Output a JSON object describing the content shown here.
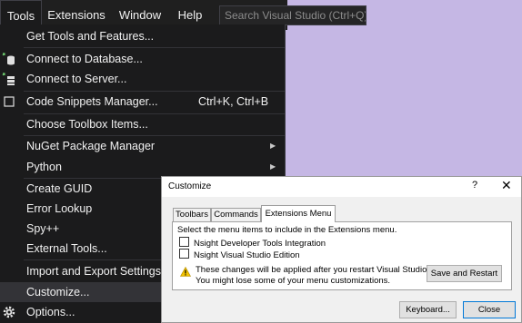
{
  "menubar": {
    "items": [
      {
        "label": "Tools",
        "active": true
      },
      {
        "label": "Extensions"
      },
      {
        "label": "Window"
      },
      {
        "label": "Help"
      }
    ],
    "search_placeholder": "Search Visual Studio (Ctrl+Q)"
  },
  "tools_menu": {
    "items": [
      {
        "label": "Get Tools and Features..."
      },
      {
        "label": "Connect to Database...",
        "icon": "database-connect-icon"
      },
      {
        "label": "Connect to Server...",
        "icon": "server-connect-icon"
      },
      {
        "label": "Code Snippets Manager...",
        "shortcut": "Ctrl+K, Ctrl+B",
        "icon": "snippet-icon"
      },
      {
        "label": "Choose Toolbox Items..."
      },
      {
        "label": "NuGet Package Manager",
        "submenu": true
      },
      {
        "label": "Python",
        "submenu": true
      },
      {
        "label": "Create GUID"
      },
      {
        "label": "Error Lookup"
      },
      {
        "label": "Spy++"
      },
      {
        "label": "External Tools..."
      },
      {
        "label": "Import and Export Settings..."
      },
      {
        "label": "Customize...",
        "highlighted": true
      },
      {
        "label": "Options...",
        "icon": "gear-icon"
      }
    ]
  },
  "dialog": {
    "title": "Customize",
    "help": "?",
    "close_glyph": "✕",
    "tabs": [
      "Toolbars",
      "Commands",
      "Extensions Menu"
    ],
    "active_tab": "Extensions Menu",
    "instruction": "Select the menu items to include in the Extensions menu.",
    "checkboxes": [
      {
        "label": "Nsight Developer Tools Integration",
        "checked": false
      },
      {
        "label": "Nsight Visual Studio Edition",
        "checked": false
      }
    ],
    "warning_line1": "These changes will be applied after you restart Visual Studio.",
    "warning_line2": "You might lose some of your menu customizations.",
    "save_restart": "Save and Restart",
    "keyboard": "Keyboard...",
    "close": "Close"
  },
  "colors": {
    "menu_bg": "#1b1b1c",
    "desktop_bg": "#c5b7e4",
    "text": "#f1f1f1",
    "hover": "#333337"
  }
}
